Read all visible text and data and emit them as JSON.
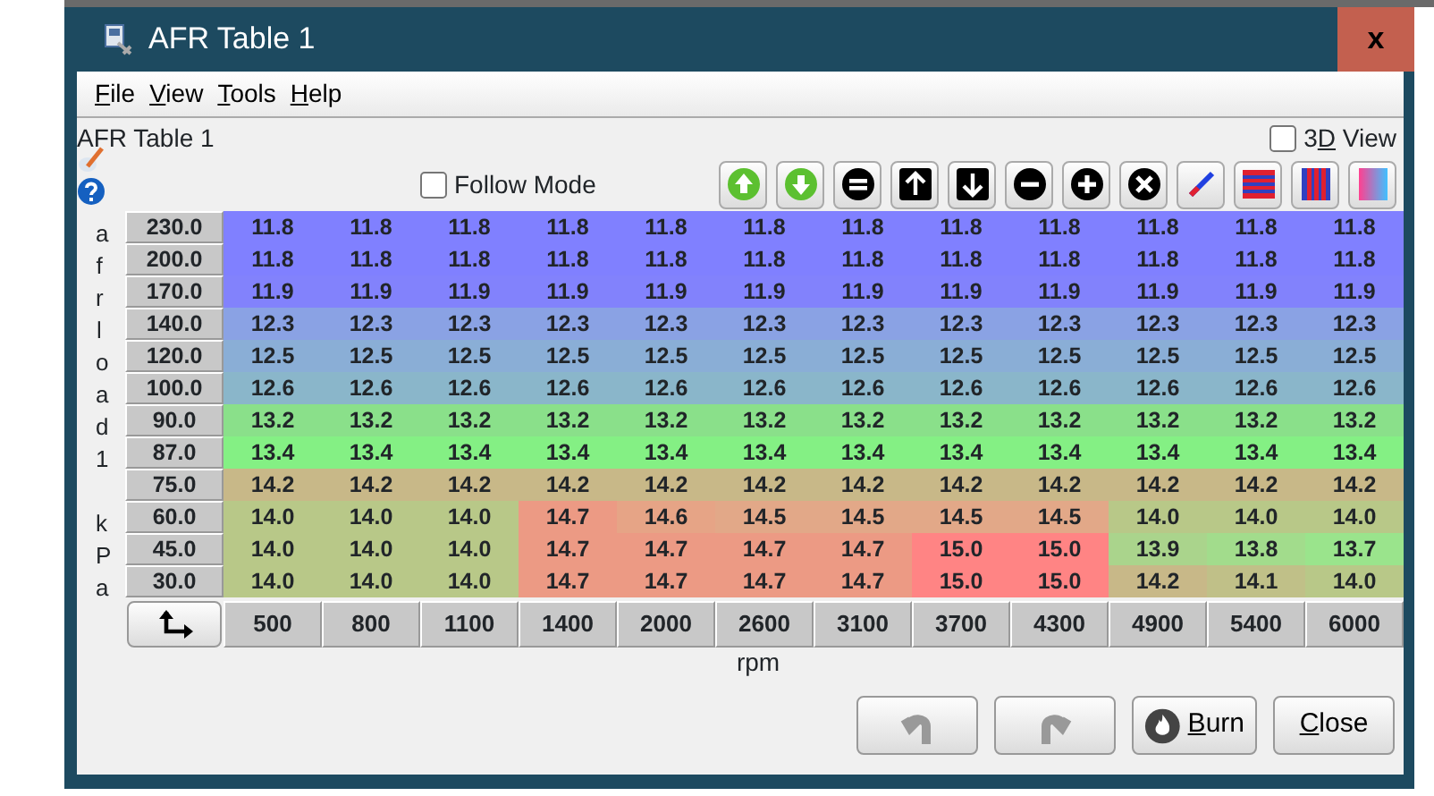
{
  "window": {
    "title": "AFR Table 1",
    "close_label": "x"
  },
  "menu": [
    "File",
    "View",
    "Tools",
    "Help"
  ],
  "table_title": "AFR Table 1",
  "view_3d": {
    "label": "3D View",
    "checked": false
  },
  "follow_mode": {
    "label": "Follow Mode",
    "checked": false
  },
  "y_axis_label": [
    "afrload1",
    "kPa"
  ],
  "rows": [
    {
      "load": "230.0",
      "cells": [
        {
          "value": "11.8",
          "color": "#8080ff"
        },
        {
          "value": "11.8",
          "color": "#8080ff"
        },
        {
          "value": "11.8",
          "color": "#8080ff"
        },
        {
          "value": "11.8",
          "color": "#8080ff"
        },
        {
          "value": "11.8",
          "color": "#8080ff"
        },
        {
          "value": "11.8",
          "color": "#8080ff"
        },
        {
          "value": "11.8",
          "color": "#8080ff"
        },
        {
          "value": "11.8",
          "color": "#8080ff"
        },
        {
          "value": "11.8",
          "color": "#8080ff"
        },
        {
          "value": "11.8",
          "color": "#8080ff"
        },
        {
          "value": "11.8",
          "color": "#8080ff"
        },
        {
          "value": "11.8",
          "color": "#8080ff"
        }
      ]
    },
    {
      "load": "200.0",
      "cells": [
        {
          "value": "11.8",
          "color": "#8080ff"
        },
        {
          "value": "11.8",
          "color": "#8080ff"
        },
        {
          "value": "11.8",
          "color": "#8080ff"
        },
        {
          "value": "11.8",
          "color": "#8080ff"
        },
        {
          "value": "11.8",
          "color": "#8080ff"
        },
        {
          "value": "11.8",
          "color": "#8080ff"
        },
        {
          "value": "11.8",
          "color": "#8080ff"
        },
        {
          "value": "11.8",
          "color": "#8080ff"
        },
        {
          "value": "11.8",
          "color": "#8080ff"
        },
        {
          "value": "11.8",
          "color": "#8080ff"
        },
        {
          "value": "11.8",
          "color": "#8080ff"
        },
        {
          "value": "11.8",
          "color": "#8080ff"
        }
      ]
    },
    {
      "load": "170.0",
      "cells": [
        {
          "value": "11.9",
          "color": "#8282fc"
        },
        {
          "value": "11.9",
          "color": "#8282fc"
        },
        {
          "value": "11.9",
          "color": "#8282fc"
        },
        {
          "value": "11.9",
          "color": "#8282fc"
        },
        {
          "value": "11.9",
          "color": "#8282fc"
        },
        {
          "value": "11.9",
          "color": "#8282fc"
        },
        {
          "value": "11.9",
          "color": "#8282fc"
        },
        {
          "value": "11.9",
          "color": "#8282fc"
        },
        {
          "value": "11.9",
          "color": "#8282fc"
        },
        {
          "value": "11.9",
          "color": "#8282fc"
        },
        {
          "value": "11.9",
          "color": "#8282fc"
        },
        {
          "value": "11.9",
          "color": "#8282fc"
        }
      ]
    },
    {
      "load": "140.0",
      "cells": [
        {
          "value": "12.3",
          "color": "#8aa2e4"
        },
        {
          "value": "12.3",
          "color": "#8aa2e4"
        },
        {
          "value": "12.3",
          "color": "#8aa2e4"
        },
        {
          "value": "12.3",
          "color": "#8aa2e4"
        },
        {
          "value": "12.3",
          "color": "#8aa2e4"
        },
        {
          "value": "12.3",
          "color": "#8aa2e4"
        },
        {
          "value": "12.3",
          "color": "#8aa2e4"
        },
        {
          "value": "12.3",
          "color": "#8aa2e4"
        },
        {
          "value": "12.3",
          "color": "#8aa2e4"
        },
        {
          "value": "12.3",
          "color": "#8aa2e4"
        },
        {
          "value": "12.3",
          "color": "#8aa2e4"
        },
        {
          "value": "12.3",
          "color": "#8aa2e4"
        }
      ]
    },
    {
      "load": "120.0",
      "cells": [
        {
          "value": "12.5",
          "color": "#8aaed6"
        },
        {
          "value": "12.5",
          "color": "#8aaed6"
        },
        {
          "value": "12.5",
          "color": "#8aaed6"
        },
        {
          "value": "12.5",
          "color": "#8aaed6"
        },
        {
          "value": "12.5",
          "color": "#8aaed6"
        },
        {
          "value": "12.5",
          "color": "#8aaed6"
        },
        {
          "value": "12.5",
          "color": "#8aaed6"
        },
        {
          "value": "12.5",
          "color": "#8aaed6"
        },
        {
          "value": "12.5",
          "color": "#8aaed6"
        },
        {
          "value": "12.5",
          "color": "#8aaed6"
        },
        {
          "value": "12.5",
          "color": "#8aaed6"
        },
        {
          "value": "12.5",
          "color": "#8aaed6"
        }
      ]
    },
    {
      "load": "100.0",
      "cells": [
        {
          "value": "12.6",
          "color": "#8ab6ca"
        },
        {
          "value": "12.6",
          "color": "#8ab6ca"
        },
        {
          "value": "12.6",
          "color": "#8ab6ca"
        },
        {
          "value": "12.6",
          "color": "#8ab6ca"
        },
        {
          "value": "12.6",
          "color": "#8ab6ca"
        },
        {
          "value": "12.6",
          "color": "#8ab6ca"
        },
        {
          "value": "12.6",
          "color": "#8ab6ca"
        },
        {
          "value": "12.6",
          "color": "#8ab6ca"
        },
        {
          "value": "12.6",
          "color": "#8ab6ca"
        },
        {
          "value": "12.6",
          "color": "#8ab6ca"
        },
        {
          "value": "12.6",
          "color": "#8ab6ca"
        },
        {
          "value": "12.6",
          "color": "#8ab6ca"
        }
      ]
    },
    {
      "load": "90.0",
      "cells": [
        {
          "value": "13.2",
          "color": "#8ae08a"
        },
        {
          "value": "13.2",
          "color": "#8ae08a"
        },
        {
          "value": "13.2",
          "color": "#8ae08a"
        },
        {
          "value": "13.2",
          "color": "#8ae08a"
        },
        {
          "value": "13.2",
          "color": "#8ae08a"
        },
        {
          "value": "13.2",
          "color": "#8ae08a"
        },
        {
          "value": "13.2",
          "color": "#8ae08a"
        },
        {
          "value": "13.2",
          "color": "#8ae08a"
        },
        {
          "value": "13.2",
          "color": "#8ae08a"
        },
        {
          "value": "13.2",
          "color": "#8ae08a"
        },
        {
          "value": "13.2",
          "color": "#8ae08a"
        },
        {
          "value": "13.2",
          "color": "#8ae08a"
        }
      ]
    },
    {
      "load": "87.0",
      "cells": [
        {
          "value": "13.4",
          "color": "#84f084"
        },
        {
          "value": "13.4",
          "color": "#84f084"
        },
        {
          "value": "13.4",
          "color": "#84f084"
        },
        {
          "value": "13.4",
          "color": "#84f084"
        },
        {
          "value": "13.4",
          "color": "#84f084"
        },
        {
          "value": "13.4",
          "color": "#84f084"
        },
        {
          "value": "13.4",
          "color": "#84f084"
        },
        {
          "value": "13.4",
          "color": "#84f084"
        },
        {
          "value": "13.4",
          "color": "#84f084"
        },
        {
          "value": "13.4",
          "color": "#84f084"
        },
        {
          "value": "13.4",
          "color": "#84f084"
        },
        {
          "value": "13.4",
          "color": "#84f084"
        }
      ]
    },
    {
      "load": "75.0",
      "cells": [
        {
          "value": "14.2",
          "color": "#c8b888"
        },
        {
          "value": "14.2",
          "color": "#c8b888"
        },
        {
          "value": "14.2",
          "color": "#c8b888"
        },
        {
          "value": "14.2",
          "color": "#c8b888"
        },
        {
          "value": "14.2",
          "color": "#c8b888"
        },
        {
          "value": "14.2",
          "color": "#c8b888"
        },
        {
          "value": "14.2",
          "color": "#c8b888"
        },
        {
          "value": "14.2",
          "color": "#c8b888"
        },
        {
          "value": "14.2",
          "color": "#c8b888"
        },
        {
          "value": "14.2",
          "color": "#c8b888"
        },
        {
          "value": "14.2",
          "color": "#c8b888"
        },
        {
          "value": "14.2",
          "color": "#c8b888"
        }
      ]
    },
    {
      "load": "60.0",
      "cells": [
        {
          "value": "14.0",
          "color": "#b8c888"
        },
        {
          "value": "14.0",
          "color": "#b8c888"
        },
        {
          "value": "14.0",
          "color": "#b8c888"
        },
        {
          "value": "14.7",
          "color": "#ec9a84"
        },
        {
          "value": "14.6",
          "color": "#e6a486"
        },
        {
          "value": "14.5",
          "color": "#e2a888"
        },
        {
          "value": "14.5",
          "color": "#e2a888"
        },
        {
          "value": "14.5",
          "color": "#e2a888"
        },
        {
          "value": "14.5",
          "color": "#e2a888"
        },
        {
          "value": "14.0",
          "color": "#b8c888"
        },
        {
          "value": "14.0",
          "color": "#b8c888"
        },
        {
          "value": "14.0",
          "color": "#b8c888"
        }
      ]
    },
    {
      "load": "45.0",
      "cells": [
        {
          "value": "14.0",
          "color": "#b8c888"
        },
        {
          "value": "14.0",
          "color": "#b8c888"
        },
        {
          "value": "14.0",
          "color": "#b8c888"
        },
        {
          "value": "14.7",
          "color": "#ec9a84"
        },
        {
          "value": "14.7",
          "color": "#ec9a84"
        },
        {
          "value": "14.7",
          "color": "#ec9a84"
        },
        {
          "value": "14.7",
          "color": "#ec9a84"
        },
        {
          "value": "15.0",
          "color": "#ff8484"
        },
        {
          "value": "15.0",
          "color": "#ff8484"
        },
        {
          "value": "13.9",
          "color": "#aad48c"
        },
        {
          "value": "13.8",
          "color": "#a2dc8c"
        },
        {
          "value": "13.7",
          "color": "#9ae48c"
        }
      ]
    },
    {
      "load": "30.0",
      "cells": [
        {
          "value": "14.0",
          "color": "#b8c888"
        },
        {
          "value": "14.0",
          "color": "#b8c888"
        },
        {
          "value": "14.0",
          "color": "#b8c888"
        },
        {
          "value": "14.7",
          "color": "#ec9a84"
        },
        {
          "value": "14.7",
          "color": "#ec9a84"
        },
        {
          "value": "14.7",
          "color": "#ec9a84"
        },
        {
          "value": "14.7",
          "color": "#ec9a84"
        },
        {
          "value": "15.0",
          "color": "#ff8484"
        },
        {
          "value": "15.0",
          "color": "#ff8484"
        },
        {
          "value": "14.2",
          "color": "#c8b888"
        },
        {
          "value": "14.1",
          "color": "#c0c088"
        },
        {
          "value": "14.0",
          "color": "#b8c888"
        }
      ]
    }
  ],
  "rpm_bins": [
    "500",
    "800",
    "1100",
    "1400",
    "2000",
    "2600",
    "3100",
    "3700",
    "4300",
    "4900",
    "5400",
    "6000"
  ],
  "x_axis_label": "rpm",
  "buttons": [
    {
      "kind": "undo",
      "disabled": true
    },
    {
      "kind": "redo",
      "disabled": true
    },
    {
      "kind": "burn",
      "label": "Burn",
      "disabled": false
    },
    {
      "kind": "close",
      "label": "Close",
      "disabled": false
    }
  ]
}
